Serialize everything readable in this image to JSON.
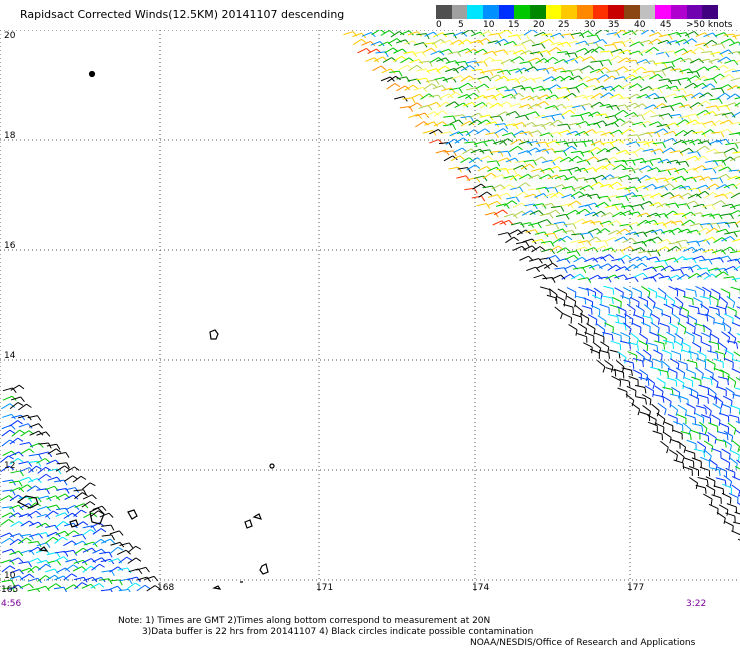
{
  "title": "Rapidsact Corrected Winds(12.5KM) 20141107 descending",
  "legend": {
    "colors": [
      "#505050",
      "#a0a0a0",
      "#00e5ff",
      "#0090ff",
      "#0030ff",
      "#00c800",
      "#008800",
      "#ffff00",
      "#ffc800",
      "#ff8800",
      "#ff3000",
      "#c80000",
      "#8b4513",
      "#c0c0c0",
      "#ff00ff",
      "#b000d0",
      "#7000b0",
      "#400080"
    ],
    "labels": [
      "0",
      "5",
      "10",
      "15",
      "20",
      "25",
      "30",
      "35",
      "40",
      "45",
      ">50 knots"
    ]
  },
  "map": {
    "y_labels": [
      "20",
      "18",
      "16",
      "14",
      "12",
      "10"
    ],
    "x_labels": [
      "165",
      "168",
      "171",
      "174",
      "177"
    ],
    "time_left": "4:56",
    "time_right": "3:22"
  },
  "notes": {
    "line1": "Note: 1) Times are GMT 2)Times along bottom correspond to measurement at 20N",
    "line2": "3)Data buffer is 22 hrs from 20141107 4) Black circles indicate possible contamination",
    "credit": "NOAA/NESDIS/Office of Research and Applications"
  }
}
